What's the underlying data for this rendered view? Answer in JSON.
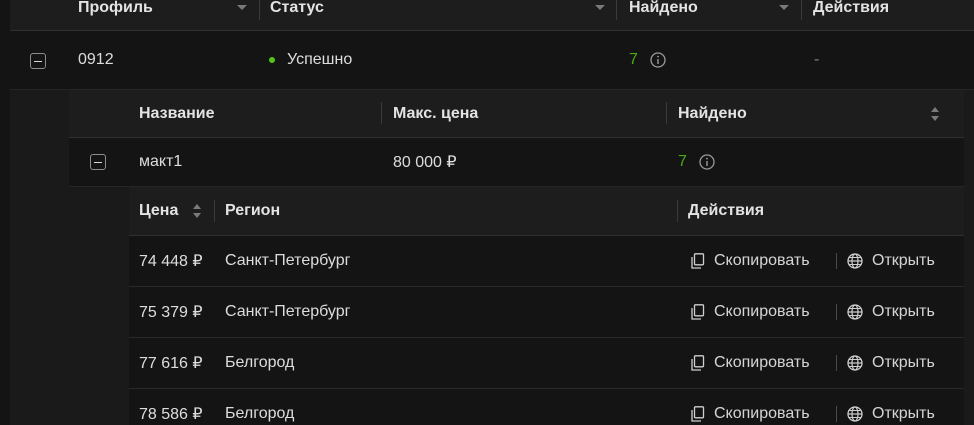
{
  "top_table": {
    "columns": [
      "Профиль",
      "Статус",
      "Найдено",
      "Действия"
    ],
    "row": {
      "profile": "0912",
      "status": "Успешно",
      "found": "7",
      "actions": "-"
    }
  },
  "nested_table": {
    "columns": [
      "Название",
      "Макс. цена",
      "Найдено"
    ],
    "row": {
      "name": "макт1",
      "max_price": "80 000 ₽",
      "found": "7"
    }
  },
  "offers_table": {
    "columns": [
      "Цена",
      "Регион",
      "Действия"
    ],
    "copy_label": "Скопировать",
    "open_label": "Открыть",
    "rows": [
      {
        "price": "74 448 ₽",
        "region": "Санкт-Петербург"
      },
      {
        "price": "75 379 ₽",
        "region": "Санкт-Петербург"
      },
      {
        "price": "77 616 ₽",
        "region": "Белгород"
      },
      {
        "price": "78 586 ₽",
        "region": "Белгород"
      }
    ]
  },
  "colors": {
    "success": "#52c41a",
    "found_count": "#49aa19",
    "background": "#141414"
  },
  "icons": [
    "filter-icon",
    "info-icon",
    "sort-icon",
    "copy-icon",
    "globe-icon",
    "minus-square-icon"
  ]
}
